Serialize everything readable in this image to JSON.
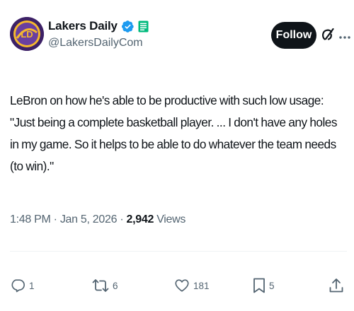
{
  "account": {
    "display_name": "Lakers Daily",
    "handle": "@LakersDailyCom",
    "avatar_icon": "lakers-daily-logo",
    "verified_icon": "verified-badge-icon",
    "affiliate_icon": "affiliate-badge-icon"
  },
  "header": {
    "follow_label": "Follow",
    "grok_icon": "grok-icon",
    "more_icon": "more-icon"
  },
  "post": {
    "text": "LeBron on how he's able to be productive with such low usage: \"Just being a complete basketball player. ... I don't have any holes in my game. So it helps to be able to do whatever the team needs (to win).\""
  },
  "meta": {
    "time": "1:48 PM",
    "separator": "·",
    "date": "Jan 5, 2026",
    "views_count": "2,942",
    "views_label": "Views"
  },
  "actions": {
    "replies": "1",
    "reposts": "6",
    "likes": "181",
    "bookmarks": "5"
  },
  "colors": {
    "text": "#0f1419",
    "secondary": "#536471",
    "verified": "#1d9bf0",
    "affiliate": "#00ba7c",
    "follow_bg": "#0f1419",
    "avatar_purple": "#4a2a7a",
    "avatar_gold": "#f5b82e"
  }
}
